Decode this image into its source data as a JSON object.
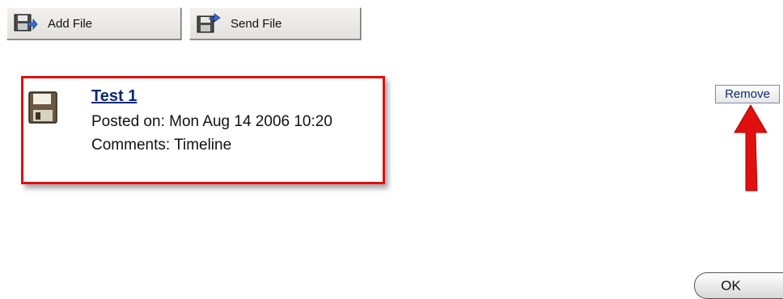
{
  "toolbar": {
    "add_file_label": "Add File",
    "send_file_label": "Send File",
    "add_file_icon": "floppy-add-icon",
    "send_file_icon": "floppy-send-icon"
  },
  "file": {
    "icon": "floppy-disk-icon",
    "title": "Test 1",
    "posted": "Posted on: Mon Aug 14 2006 10:20",
    "comments": "Comments: Timeline"
  },
  "actions": {
    "remove_label": "Remove",
    "ok_label": "OK"
  },
  "colors": {
    "highlight_border": "#e01010",
    "arrow": "#e01010",
    "link": "#0b2a6e"
  }
}
